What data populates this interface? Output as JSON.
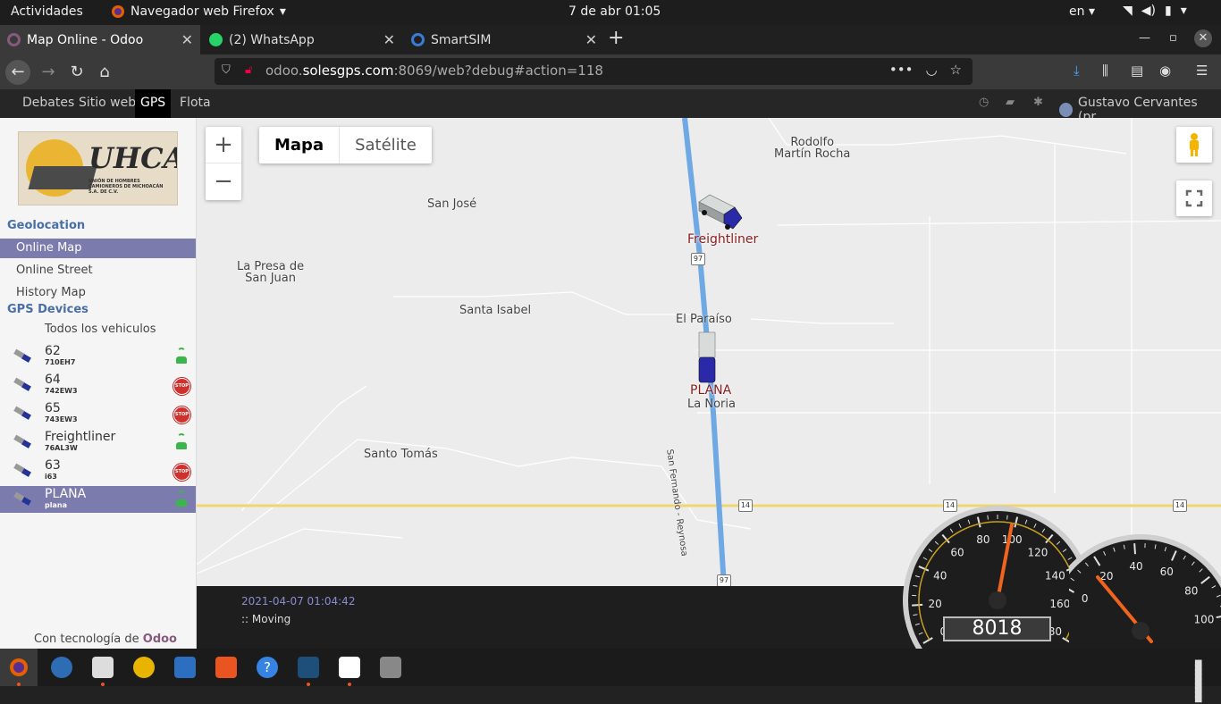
{
  "os_bar": {
    "activities": "Actividades",
    "app_name": "Navegador web Firefox",
    "clock": "7 de abr  01:05",
    "lang": "en"
  },
  "tabs": [
    {
      "title": "Map Online - Odoo",
      "icon": "odoo-icon",
      "color": "#875a7b"
    },
    {
      "title": "(2) WhatsApp",
      "icon": "whatsapp-icon",
      "color": "#25d366"
    },
    {
      "title": "SmartSIM",
      "icon": "smartsim-icon",
      "color": "#3b7bd6"
    }
  ],
  "url": {
    "prefix": "odoo.",
    "host": "solesgps.com",
    "rest": ":8069/web?debug#action=118"
  },
  "odoo_menu": {
    "items": [
      "Debates",
      "Sitio web",
      "GPS",
      "Flota"
    ],
    "active": "GPS",
    "user": "Gustavo Cervantes (pr..."
  },
  "sidebar": {
    "logo_text": "UHCAM",
    "logo_sub": "UNIÓN DE HOMBRES CAMIONEROS DE MICHOACÁN S.A. DE C.V.",
    "section_geo": "Geolocation",
    "geo_items": [
      "Online Map",
      "Online Street",
      "History Map"
    ],
    "section_devices": "GPS Devices",
    "all_vehicles": "Todos los vehiculos",
    "devices": [
      {
        "name": "62",
        "plate": "710EH7",
        "status": "moving"
      },
      {
        "name": "64",
        "plate": "742EW3",
        "status": "stop"
      },
      {
        "name": "65",
        "plate": "743EW3",
        "status": "stop"
      },
      {
        "name": "Freightliner",
        "plate": "76AL3W",
        "status": "moving"
      },
      {
        "name": "63",
        "plate": "i63",
        "status": "stop"
      },
      {
        "name": "PLANA",
        "plate": "plana",
        "status": "moving"
      }
    ],
    "stop_text": "STOP",
    "powered_prefix": "Con tecnología de",
    "powered_brand": "Odoo"
  },
  "map": {
    "map_type": [
      "Mapa",
      "Satélite"
    ],
    "places": {
      "rodolfo": "Rodolfo\nMartín Rocha",
      "san_jose": "San José",
      "la_presa": "La Presa de\nSan Juan",
      "santa_isabel": "Santa Isabel",
      "el_paraiso": "El Paraíso",
      "la_noria": "La Noria",
      "santo_tomas": "Santo Tomás",
      "road_name": "San Fernando - Reynosa"
    },
    "vehicle_labels": [
      "Freightliner",
      "PLANA"
    ],
    "shields": [
      "97",
      "14",
      "14",
      "14",
      "97"
    ]
  },
  "info": {
    "timestamp": "2021-04-07 01:04:42",
    "status": ":: Moving"
  },
  "speedometer": {
    "ticks": [
      "0",
      "20",
      "40",
      "60",
      "80",
      "100",
      "120",
      "140",
      "160",
      "180"
    ],
    "odometer": "8018",
    "speed": 98
  },
  "rpm": {
    "ticks": [
      "0",
      "20",
      "40",
      "60",
      "80",
      "100"
    ],
    "value": 0
  }
}
